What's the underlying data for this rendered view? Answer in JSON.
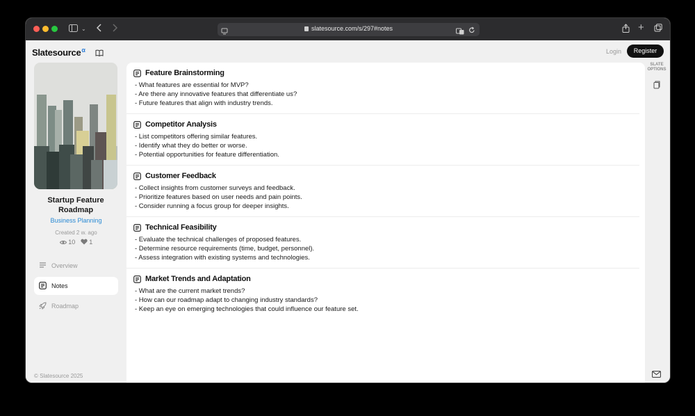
{
  "browser": {
    "url": "slatesource.com/s/297#notes"
  },
  "header": {
    "logo": "Slatesource",
    "logo_mark": "α",
    "login_label": "Login",
    "register_label": "Register"
  },
  "sidebar": {
    "title": "Startup Feature Roadmap",
    "category": "Business Planning",
    "created": "Created 2 w. ago",
    "views": "10",
    "likes": "1",
    "nav": [
      {
        "label": "Overview",
        "icon": "list-icon"
      },
      {
        "label": "Notes",
        "icon": "notes-icon"
      },
      {
        "label": "Roadmap",
        "icon": "rocket-icon"
      }
    ],
    "copyright": "© Slatesource 2025"
  },
  "notes": [
    {
      "title": "Feature Brainstorming",
      "lines": [
        "- What features are essential for MVP?",
        "- Are there any innovative features that differentiate us?",
        "- Future features that align with industry trends."
      ]
    },
    {
      "title": "Competitor Analysis",
      "lines": [
        "- List competitors offering similar features.",
        "- Identify what they do better or worse.",
        "- Potential opportunities for feature differentiation."
      ]
    },
    {
      "title": "Customer Feedback",
      "lines": [
        "- Collect insights from customer surveys and feedback.",
        "- Prioritize features based on user needs and pain points.",
        "- Consider running a focus group for deeper insights."
      ]
    },
    {
      "title": "Technical Feasibility",
      "lines": [
        "- Evaluate the technical challenges of proposed features.",
        "- Determine resource requirements (time, budget, personnel).",
        "- Assess integration with existing systems and technologies."
      ]
    },
    {
      "title": "Market Trends and Adaptation",
      "lines": [
        "- What are the current market trends?",
        "- How can our roadmap adapt to changing industry standards?",
        "- Keep an eye on emerging technologies that could influence our feature set."
      ]
    }
  ],
  "rail": {
    "label_line1": "SLATE",
    "label_line2": "OPTIONS"
  }
}
